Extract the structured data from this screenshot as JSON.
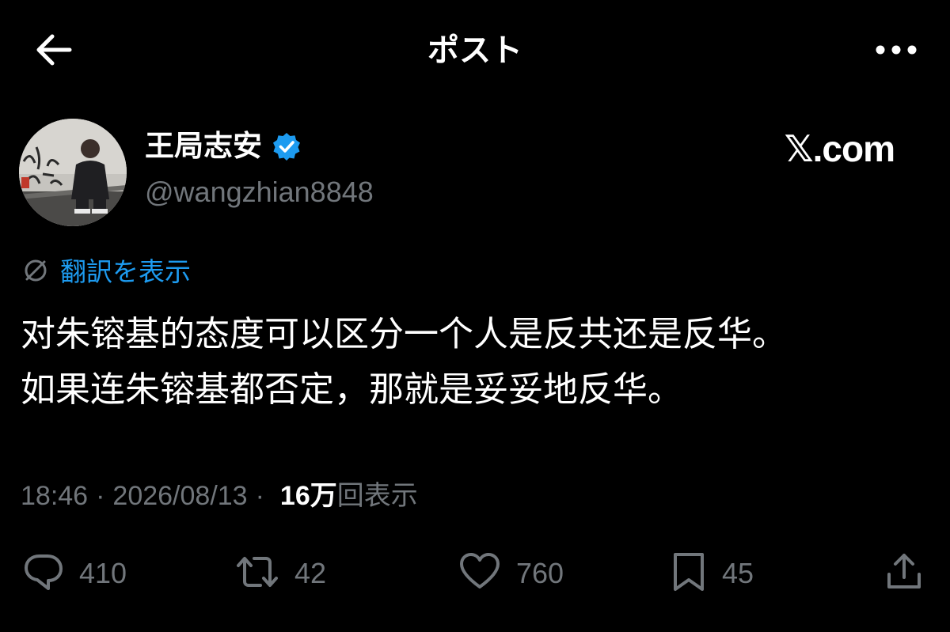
{
  "header": {
    "title": "ポスト",
    "back_icon": "arrow-left-icon",
    "more_icon": "more-horizontal-icon"
  },
  "author": {
    "display_name": "王局志安",
    "handle": "@wangzhian8848",
    "verified_icon": "verified-badge-icon",
    "verified_color": "#1d9bf0"
  },
  "brand": {
    "label": "𝕏.com"
  },
  "translate": {
    "icon": "globe-icon",
    "label": "翻訳を表示",
    "color": "#1d9bf0"
  },
  "post": {
    "lines": [
      "对朱镕基的态度可以区分一个人是反共还是反华。",
      "如果连朱镕基都否定，那就是妥妥地反华。"
    ]
  },
  "meta": {
    "time": "18:46",
    "date": "2026/08/13",
    "separator": "·",
    "views_count": "16万",
    "views_label": "回表示"
  },
  "actions": {
    "reply": {
      "icon": "reply-icon",
      "count": "410"
    },
    "repost": {
      "icon": "repost-icon",
      "count": "42"
    },
    "like": {
      "icon": "heart-icon",
      "count": "760"
    },
    "bookmark": {
      "icon": "bookmark-icon",
      "count": "45"
    },
    "share": {
      "icon": "share-icon"
    }
  },
  "colors": {
    "background": "#000000",
    "text": "#ffffff",
    "secondary": "#71767b",
    "accent": "#1d9bf0"
  }
}
